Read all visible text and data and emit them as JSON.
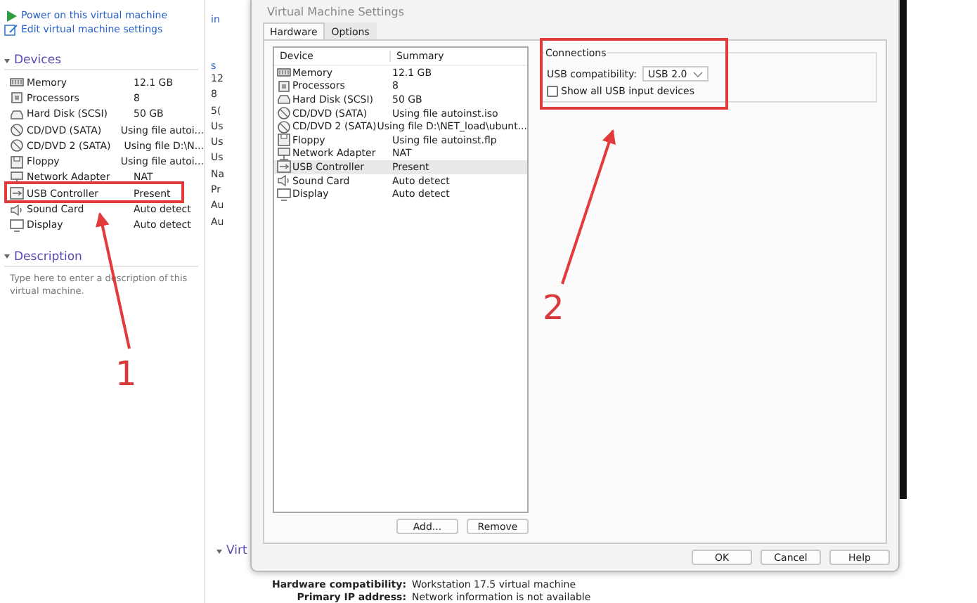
{
  "left_panel": {
    "actions": [
      {
        "kind": "play",
        "label": "Power on this virtual machine"
      },
      {
        "kind": "edit",
        "label": "Edit virtual machine settings"
      }
    ],
    "devices_header": "Devices",
    "devices": [
      {
        "kind": "memory",
        "name": "Memory",
        "summary": "12.1 GB"
      },
      {
        "kind": "cpu",
        "name": "Processors",
        "summary": "8"
      },
      {
        "kind": "disk",
        "name": "Hard Disk (SCSI)",
        "summary": "50 GB"
      },
      {
        "kind": "cd",
        "name": "CD/DVD (SATA)",
        "summary": "Using file autoi..."
      },
      {
        "kind": "cd",
        "name": "CD/DVD 2 (SATA)",
        "summary": "Using file D:\\N..."
      },
      {
        "kind": "floppy",
        "name": "Floppy",
        "summary": "Using file autoi..."
      },
      {
        "kind": "network",
        "name": "Network Adapter",
        "summary": "NAT"
      },
      {
        "kind": "usb",
        "name": "USB Controller",
        "summary": "Present"
      },
      {
        "kind": "sound",
        "name": "Sound Card",
        "summary": "Auto detect"
      },
      {
        "kind": "display",
        "name": "Display",
        "summary": "Auto detect"
      }
    ],
    "description_header": "Description",
    "description_placeholder": "Type here to enter a description of this virtual machine."
  },
  "middle_fragments": [
    "in",
    "s",
    "12",
    "8",
    "5(",
    "Us",
    "Us",
    "Us",
    "Na",
    "Pr",
    "Au",
    "Au"
  ],
  "details": {
    "header": "Virt",
    "rows": [
      {
        "label": "Hardware compatibility:",
        "value": "Workstation 17.5 virtual machine"
      },
      {
        "label": "Primary IP address:",
        "value": "Network information is not available"
      }
    ]
  },
  "dialog": {
    "title": "Virtual Machine Settings",
    "tabs": [
      {
        "label": "Hardware",
        "selected": true
      },
      {
        "label": "Options",
        "selected": false
      }
    ],
    "columns": [
      "Device",
      "Summary"
    ],
    "rows": [
      {
        "kind": "memory",
        "device": "Memory",
        "summary": "12.1 GB",
        "selected": false
      },
      {
        "kind": "cpu",
        "device": "Processors",
        "summary": "8",
        "selected": false
      },
      {
        "kind": "disk",
        "device": "Hard Disk (SCSI)",
        "summary": "50 GB",
        "selected": false
      },
      {
        "kind": "cd",
        "device": "CD/DVD (SATA)",
        "summary": "Using file autoinst.iso",
        "selected": false
      },
      {
        "kind": "cd",
        "device": "CD/DVD 2 (SATA)",
        "summary": "Using file D:\\NET_load\\ubunt...",
        "selected": false
      },
      {
        "kind": "floppy",
        "device": "Floppy",
        "summary": "Using file autoinst.flp",
        "selected": false
      },
      {
        "kind": "network",
        "device": "Network Adapter",
        "summary": "NAT",
        "selected": false
      },
      {
        "kind": "usb",
        "device": "USB Controller",
        "summary": "Present",
        "selected": true
      },
      {
        "kind": "sound",
        "device": "Sound Card",
        "summary": "Auto detect",
        "selected": false
      },
      {
        "kind": "display",
        "device": "Display",
        "summary": "Auto detect",
        "selected": false
      }
    ],
    "list_buttons": [
      "Add...",
      "Remove"
    ],
    "connections": {
      "legend": "Connections",
      "compat_label": "USB compatibility:",
      "compat_value": "USB 2.0",
      "show_all": {
        "label": "Show all USB input devices",
        "checked": false
      }
    },
    "footer_buttons": [
      "OK",
      "Cancel",
      "Help"
    ]
  },
  "annotations": [
    {
      "label": "1"
    },
    {
      "label": "2"
    }
  ]
}
